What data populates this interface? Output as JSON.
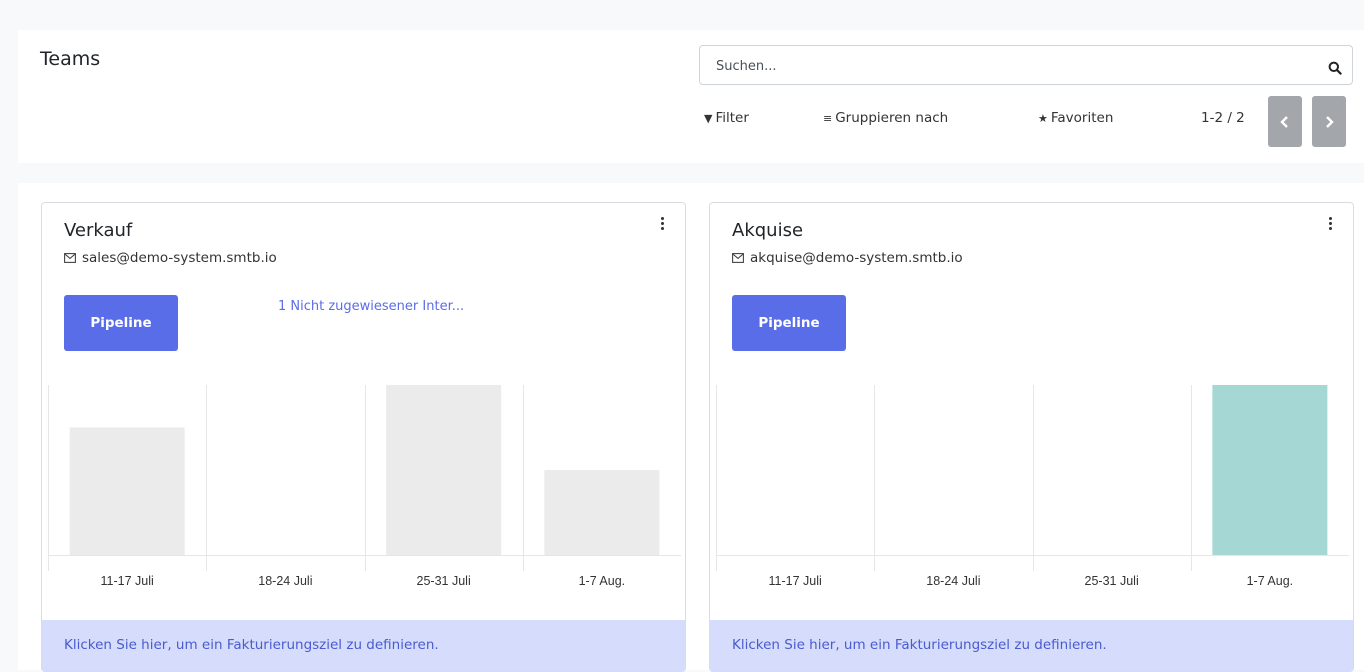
{
  "header": {
    "title": "Teams",
    "search_placeholder": "Suchen...",
    "filter_label": "Filter",
    "group_label": "Gruppieren nach",
    "favorites_label": "Favoriten",
    "pager_value": "1-2 / 2"
  },
  "icons": {
    "filter": "funnel-icon",
    "group": "list-icon",
    "favorites": "star-icon",
    "search": "search-icon",
    "email": "envelope-icon",
    "menu": "kebab-menu-icon",
    "prev": "chevron-left-icon",
    "next": "chevron-right-icon"
  },
  "colors": {
    "accent": "#5a6de8",
    "footer_bg": "#d6dcfb",
    "footer_text": "#4a5bcf",
    "bar_past": "#ebebeb",
    "bar_current": "#a5d8d4",
    "pager_button": "#a3a6ab"
  },
  "cards": [
    {
      "name": "Verkauf",
      "email": "sales@demo-system.smtb.io",
      "pipeline_label": "Pipeline",
      "unassigned_label": "1 Nicht zugewiesener Inter...",
      "footer_text": "Klicken Sie hier, um ein Fakturierungsziel zu definieren."
    },
    {
      "name": "Akquise",
      "email": "akquise@demo-system.smtb.io",
      "pipeline_label": "Pipeline",
      "unassigned_label": "",
      "footer_text": "Klicken Sie hier, um ein Fakturierungsziel zu definieren."
    }
  ],
  "chart_data": [
    {
      "type": "bar",
      "categories": [
        "11-17 Juli",
        "18-24 Juli",
        "25-31 Juli",
        "1-7 Aug."
      ],
      "values": [
        3,
        0,
        4,
        2
      ],
      "ylim": [
        0,
        4
      ],
      "highlight_index": null,
      "grid": true
    },
    {
      "type": "bar",
      "categories": [
        "11-17 Juli",
        "18-24 Juli",
        "25-31 Juli",
        "1-7 Aug."
      ],
      "values": [
        0,
        0,
        0,
        1
      ],
      "ylim": [
        0,
        1
      ],
      "highlight_index": 3,
      "grid": true
    }
  ]
}
